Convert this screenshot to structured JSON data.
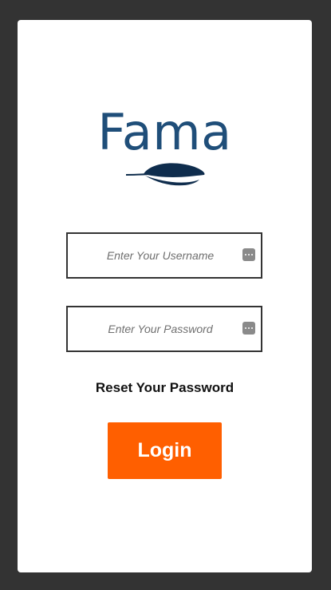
{
  "brand": {
    "name": "Fama",
    "color": "#1f4e79",
    "mark_icon": "feather-icon"
  },
  "form": {
    "username": {
      "placeholder": "Enter Your Username",
      "value": "",
      "icon": "password-manager-icon"
    },
    "password": {
      "placeholder": "Enter Your Password",
      "value": "",
      "icon": "password-manager-icon"
    },
    "reset_link": "Reset Your Password",
    "login_label": "Login",
    "login_color": "#ff5f00"
  }
}
